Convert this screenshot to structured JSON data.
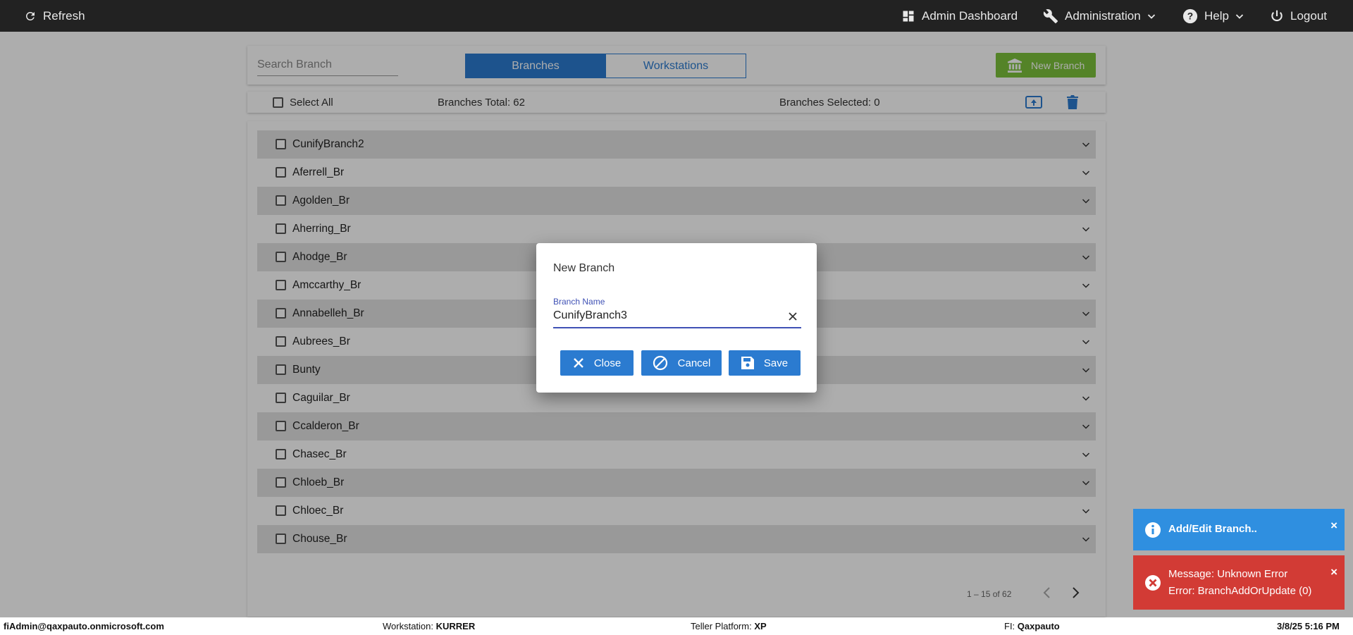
{
  "topbar": {
    "refresh": "Refresh",
    "admin_dashboard": "Admin Dashboard",
    "administration": "Administration",
    "help": "Help",
    "logout": "Logout"
  },
  "controls": {
    "search_placeholder": "Search Branch",
    "tab_branches": "Branches",
    "tab_workstations": "Workstations",
    "new_branch": "New Branch"
  },
  "toolbar": {
    "select_all": "Select All",
    "total": "Branches Total: 62",
    "selected": "Branches Selected: 0"
  },
  "branches": [
    "CunifyBranch2",
    "Aferrell_Br",
    "Agolden_Br",
    "Aherring_Br",
    "Ahodge_Br",
    "Amccarthy_Br",
    "Annabelleh_Br",
    "Aubrees_Br",
    "Bunty",
    "Caguilar_Br",
    "Ccalderon_Br",
    "Chasec_Br",
    "Chloeb_Br",
    "Chloec_Br",
    "Chouse_Br"
  ],
  "pagination": {
    "range": "1 – 15 of 62"
  },
  "dialog": {
    "title": "New Branch",
    "field_label": "Branch Name",
    "field_value": "CunifyBranch3",
    "close": "Close",
    "cancel": "Cancel",
    "save": "Save"
  },
  "toasts": {
    "info": "Add/Edit Branch..",
    "error_line1": "Message: Unknown Error",
    "error_line2": "Error: BranchAddOrUpdate (0)",
    "close_glyph": "×"
  },
  "status": {
    "user": "fiAdmin@qaxpauto.onmicrosoft.com",
    "workstation_label": "Workstation: ",
    "workstation_value": "KURRER",
    "platform_label": "Teller Platform: ",
    "platform_value": "XP",
    "fi_label": "FI: ",
    "fi_value": "Qaxpauto",
    "datetime": "3/8/25 5:16 PM"
  },
  "colors": {
    "primary": "#2b7bd0",
    "new_branch_green": "#7cc23b",
    "info_toast": "#2f8fe0",
    "error_toast": "#d23b35",
    "topbar": "#222222"
  }
}
